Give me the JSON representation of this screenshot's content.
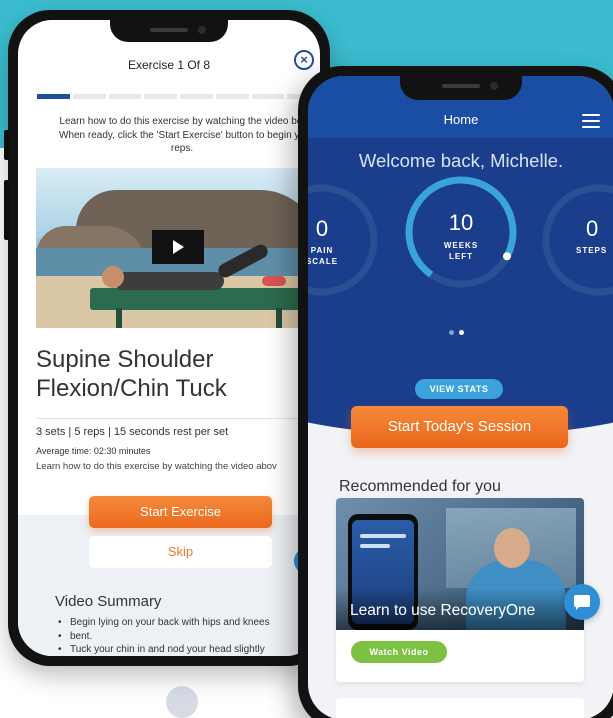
{
  "left_screen": {
    "header": "Exercise 1 Of 8",
    "progress": {
      "current": 1,
      "total": 8
    },
    "intro_lines": [
      "Learn how to do this exercise by watching the video bel",
      "When ready, click the 'Start Exercise' button to begin yo",
      "reps."
    ],
    "title_line1": "Supine Shoulder",
    "title_line2": "Flexion/Chin Tuck",
    "sets": "3 sets | 5 reps | 15 seconds rest per set",
    "average_time": "Average time: 02:30 minutes",
    "learn": "Learn how to do this exercise by watching the video abov",
    "start_button": "Start Exercise",
    "skip_button": "Skip",
    "summary_heading": "Video Summary",
    "summary_items": [
      "Begin lying on your back with hips and knees",
      "bent.",
      "Tuck your chin in and nod your head slightly"
    ]
  },
  "right_screen": {
    "title": "Home",
    "welcome": "Welcome back, Michelle.",
    "stats": [
      {
        "value": "0",
        "label_line1": "PAIN",
        "label_line2": "SCALE",
        "progress": 0
      },
      {
        "value": "10",
        "label_line1": "WEEKS",
        "label_line2": "LEFT",
        "progress": 0.73
      },
      {
        "value": "0",
        "label_line1": "STEPS",
        "label_line2": "",
        "progress": 0
      }
    ],
    "carousel": {
      "pages": 2,
      "active": 2
    },
    "view_stats_button": "VIEW STATS",
    "session_button": "Start Today's Session",
    "recommended_heading": "Recommended for you",
    "card": {
      "caption": "Learn to use RecoveryOne",
      "watch_button": "Watch Video"
    }
  },
  "colors": {
    "teal_band": "#3bbccf",
    "navy": "#1b3e8c",
    "orange": "#ec6a1e",
    "ring_blue": "#3aa2dd",
    "green": "#7cc142"
  }
}
